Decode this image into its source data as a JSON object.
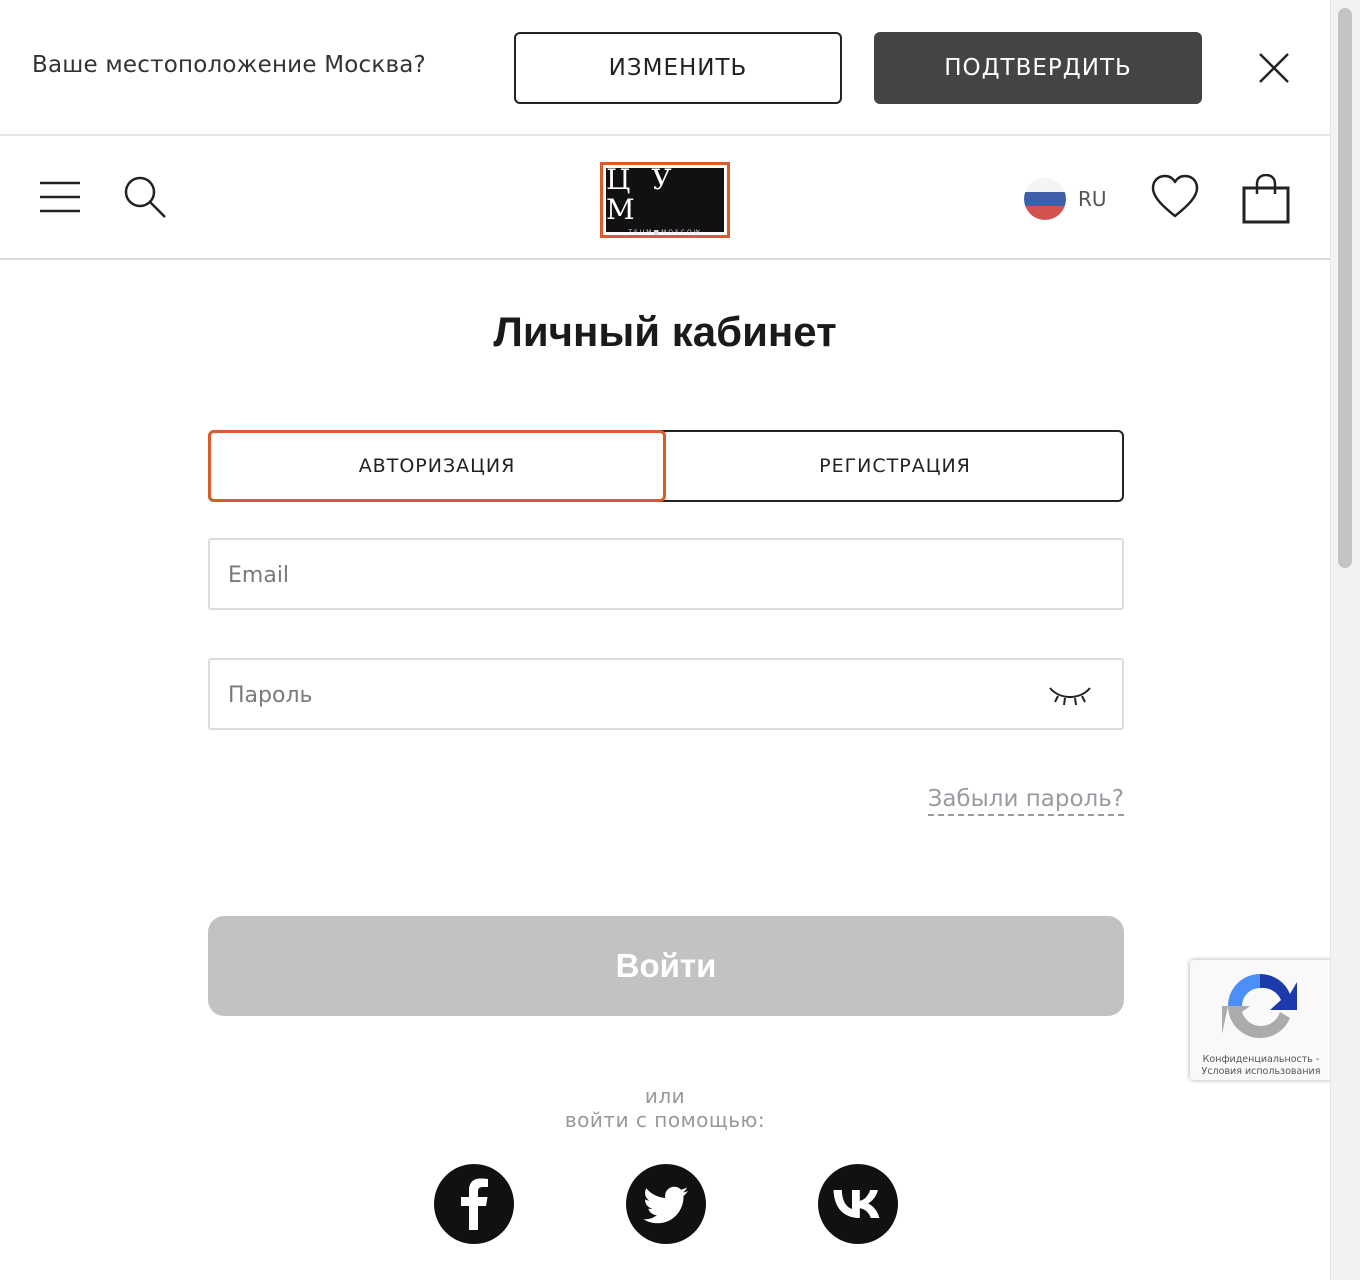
{
  "geo_bar": {
    "question": "Ваше местоположение Москва?",
    "change_label": "ИЗМЕНИТЬ",
    "confirm_label": "ПОДТВЕРДИТЬ",
    "close_icon": "close-icon"
  },
  "header": {
    "menu_icon": "menu-icon",
    "search_icon": "search-icon",
    "logo": {
      "main": "Ц У М",
      "sub": "TSUM■MOSCOW"
    },
    "language": {
      "flag": "russia-flag",
      "label": "RU"
    },
    "wishlist_icon": "heart-icon",
    "cart_icon": "shopping-bag-icon"
  },
  "main": {
    "title": "Личный кабинет",
    "tabs": [
      {
        "label": "АВТОРИЗАЦИЯ",
        "active": true
      },
      {
        "label": "РЕГИСТРАЦИЯ",
        "active": false
      }
    ],
    "email": {
      "placeholder": "Email",
      "value": ""
    },
    "password": {
      "placeholder": "Пароль",
      "value": "",
      "toggle_icon": "eye-closed-icon"
    },
    "forgot_label": "Забыли пароль?",
    "login_label": "Войти",
    "or_label": "или",
    "social_label": "войти с помощью:",
    "social": [
      {
        "name": "facebook",
        "icon": "facebook-icon"
      },
      {
        "name": "twitter",
        "icon": "twitter-icon"
      },
      {
        "name": "vk",
        "icon": "vk-icon"
      }
    ]
  },
  "recaptcha": {
    "line1": "Конфиденциальность -",
    "line2": "Условия использования"
  },
  "colors": {
    "accent": "#e0592a",
    "dark_button": "#444444",
    "disabled_button": "#c2c2c2",
    "flag_white": "#f4f4f4",
    "flag_blue": "#3f5fa8",
    "flag_red": "#d2524f"
  }
}
